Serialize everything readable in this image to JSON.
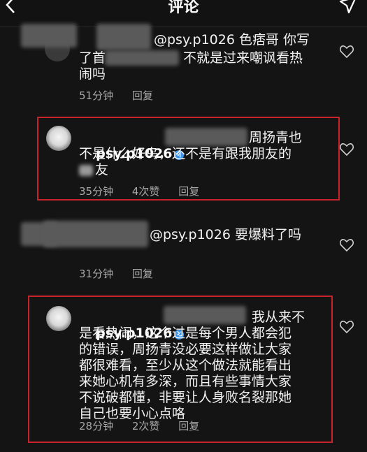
{
  "header": {
    "title": "评论"
  },
  "comments": [
    {
      "mention": "@psy.p1026 色痞哥 你写",
      "line2a": "了首",
      "line2b": "不就是过来嘲讽看热",
      "line3": "闹吗",
      "time": "51分钟",
      "reply": "回复"
    },
    {
      "username": "psy.p1026",
      "line1": "周扬青也",
      "line2": "不是什么好鸟，还不是有跟我朋友的",
      "line3": "友",
      "time": "35分钟",
      "likes": "4次赞",
      "reply": "回复"
    },
    {
      "mention": "@psy.p1026 要爆料了吗",
      "time": "31分钟",
      "reply": "回复"
    },
    {
      "username": "psy.p1026",
      "line1": "我从来不",
      "body": "是看热闹，这个过是每个男人都会犯\n的错误，周扬青没必要这样做让大家\n都很难看，至少从这个做法就能看出\n来她心机有多深，而且有些事情大家\n不说破都懂，非要让人身败名裂那她\n自己也要小心点咯",
      "time": "28分钟",
      "likes": "2次赞",
      "reply": "回复"
    }
  ],
  "colors": {
    "highlight_frame": "#c8232a",
    "verified": "#3897f0",
    "background": "#141414"
  },
  "icons": [
    "back-icon",
    "send-icon",
    "heart-icon",
    "verified-badge-icon"
  ]
}
